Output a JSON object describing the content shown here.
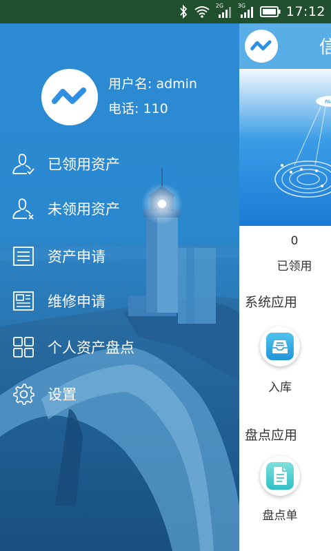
{
  "status_bar": {
    "time": "17:12",
    "network_1": "2G",
    "network_2": "3G",
    "icons": [
      "bluetooth-icon",
      "wifi-icon",
      "signal-icon",
      "signal-icon",
      "battery-icon"
    ]
  },
  "profile": {
    "username": "用户名: admin",
    "phone": "电话: 110"
  },
  "menu": {
    "items": [
      {
        "label": "已领用资产",
        "icon": "user-check-icon"
      },
      {
        "label": "未领用资产",
        "icon": "user-x-icon"
      },
      {
        "label": "资产申请",
        "icon": "list-icon"
      },
      {
        "label": "维修申请",
        "icon": "newspaper-icon"
      },
      {
        "label": "个人资产盘点",
        "icon": "grid-icon"
      },
      {
        "label": "设置",
        "icon": "gear-icon"
      }
    ]
  },
  "main": {
    "header_title": "信",
    "stats": {
      "count": "0",
      "label": "已领用"
    },
    "sections": [
      {
        "title": "系统应用",
        "app_label": "入库",
        "app_icon": "inbox-icon"
      },
      {
        "title": "盘点应用",
        "app_label": "盘点单",
        "app_icon": "document-icon"
      }
    ]
  },
  "colors": {
    "status_bar": "#1f4f2c",
    "drawer_blue": "#2a88ce",
    "header_blue": "#5aaee8",
    "app_icon_gradient_top": "#4fc3ec",
    "app_icon_gradient_bottom": "#2196d8"
  }
}
